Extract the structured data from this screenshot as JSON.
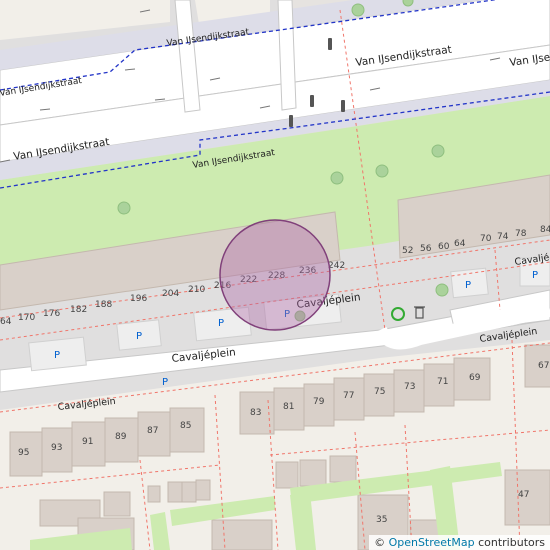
{
  "streets": {
    "top_right": "Van IJsendijkstraat",
    "top_right2": "Van IJsendijkstraat",
    "top_left": "Van IJsendijkstraat",
    "upper_label": "Van IJsendijkstraat",
    "mid_left": "Van IJsendijkstraat",
    "mid_label": "Van IJsendijkstraat",
    "cav_main": "Cavaljéplein",
    "cav_upper": "Cavaljéplein",
    "cav_left": "Cavaljéplein",
    "cav_right": "Cavaljéplein",
    "cav_far_right": "Cavaljé"
  },
  "row_numbers": [
    "64",
    "170",
    "176",
    "182",
    "188",
    "196",
    "204",
    "210",
    "216",
    "222",
    "228",
    "236",
    "242"
  ],
  "east_numbers": [
    "52",
    "56",
    "60",
    "64",
    "70",
    "74",
    "78",
    "84"
  ],
  "mid_numbers": [
    "83",
    "81",
    "79",
    "77",
    "75",
    "73",
    "71",
    "69",
    "67"
  ],
  "south_numbers": [
    "95",
    "93",
    "91",
    "89",
    "87",
    "85"
  ],
  "far_numbers": [
    "47",
    "35"
  ],
  "parking_label": "P",
  "icons": [
    "recycling-icon",
    "waste-basket-icon",
    "traffic-signal-icon",
    "tree-icon",
    "parking-icon"
  ],
  "attribution": {
    "copyright": "©",
    "link": "OpenStreetMap",
    "suffix": "contributors"
  },
  "colors": {
    "background": "#f2efe9",
    "road": "#ffffff",
    "footway": "#dddde8",
    "park": "#cdebb0",
    "building": "#d9d0c9",
    "boundary": "#f0756a",
    "bus_route": "#2335c8",
    "marker_fill": "#b06aa8",
    "marker_stroke": "#80407a"
  }
}
